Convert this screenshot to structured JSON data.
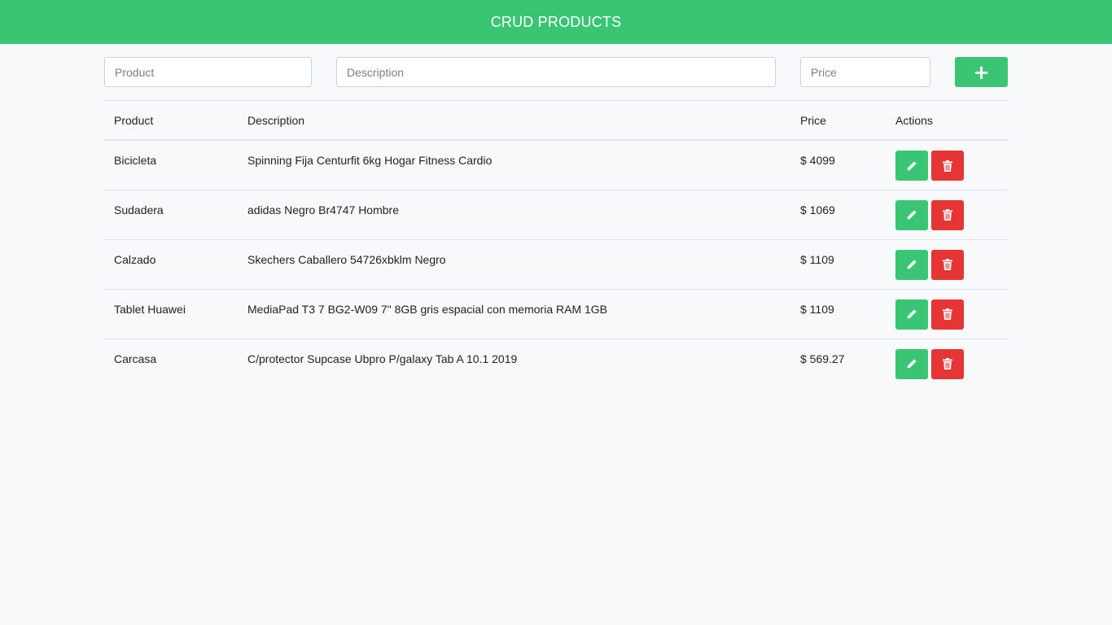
{
  "header": {
    "title": "CRUD PRODUCTS"
  },
  "form": {
    "product_placeholder": "Product",
    "description_placeholder": "Description",
    "price_placeholder": "Price",
    "add_label": "+"
  },
  "table": {
    "headers": {
      "product": "Product",
      "description": "Description",
      "price": "Price",
      "actions": "Actions"
    },
    "rows": [
      {
        "product": "Bicicleta",
        "description": "Spinning Fija Centurfit 6kg Hogar Fitness Cardio",
        "price": "$ 4099"
      },
      {
        "product": "Sudadera",
        "description": "adidas Negro Br4747 Hombre",
        "price": "$ 1069"
      },
      {
        "product": "Calzado",
        "description": "Skechers Caballero 54726xbklm Negro",
        "price": "$ 1109"
      },
      {
        "product": "Tablet Huawei",
        "description": "MediaPad T3 7 BG2-W09 7\" 8GB gris espacial con memoria RAM 1GB",
        "price": "$ 1109"
      },
      {
        "product": "Carcasa",
        "description": "C/protector Supcase Ubpro P/galaxy Tab A 10.1 2019",
        "price": "$ 569.27"
      }
    ]
  },
  "icons": {
    "edit": "pencil-icon",
    "delete": "trash-icon",
    "add": "plus-icon"
  },
  "colors": {
    "primary": "#39c574",
    "danger": "#e53535",
    "background": "#f7f9fb"
  }
}
